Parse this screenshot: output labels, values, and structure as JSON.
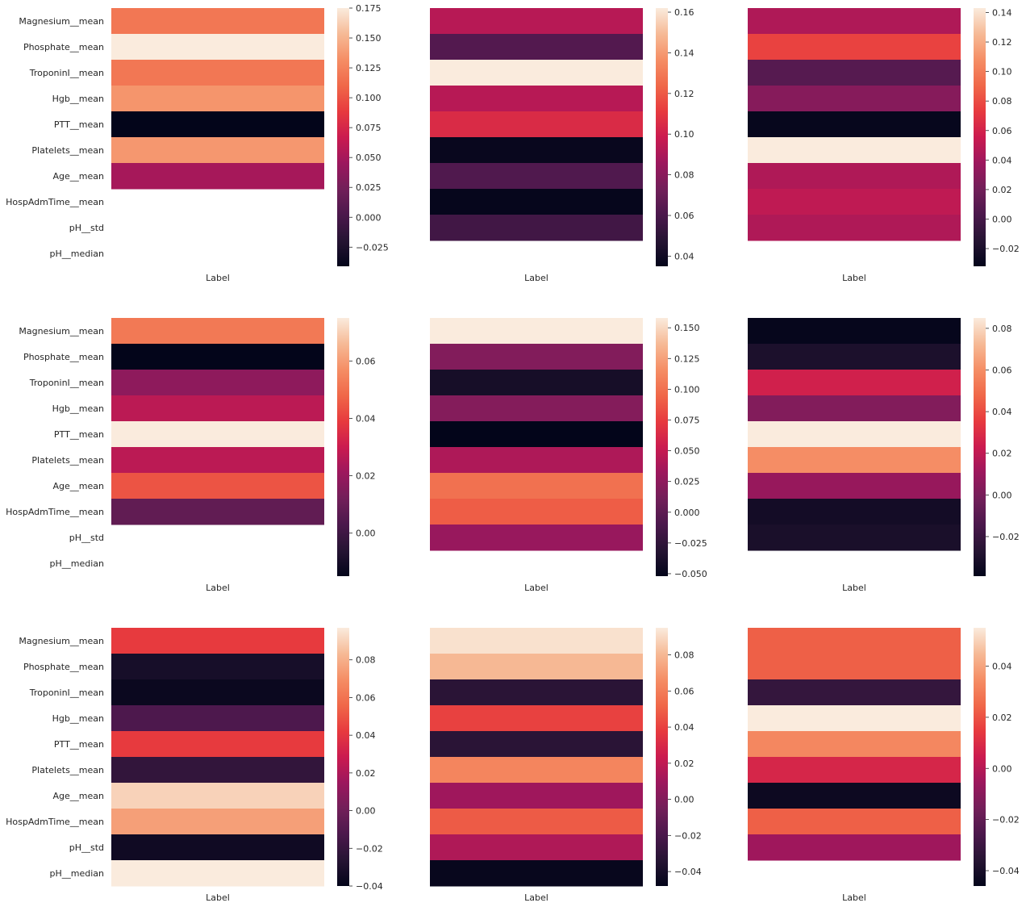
{
  "chart_data": [
    {
      "type": "heatmap",
      "xlabel": "Label",
      "ylabel": "",
      "show_row_labels": true,
      "rows": [
        "Magnesium__mean",
        "Phosphate__mean",
        "TroponinI__mean",
        "Hgb__mean",
        "PTT__mean",
        "Platelets__mean",
        "Age__mean",
        "HospAdmTime__mean",
        "pH__std",
        "pH__median"
      ],
      "values": [
        0.119,
        0.175,
        0.119,
        0.135,
        -0.041,
        0.136,
        0.05,
        null,
        null,
        null
      ],
      "vmin": -0.041,
      "vmax": 0.175,
      "colorbar_ticks": [
        -0.025,
        0.0,
        0.025,
        0.05,
        0.075,
        0.1,
        0.125,
        0.15,
        0.175
      ],
      "colorbar_tick_labels": [
        "−0.025",
        "0.000",
        "0.025",
        "0.050",
        "0.075",
        "0.100",
        "0.125",
        "0.150",
        "0.175"
      ]
    },
    {
      "type": "heatmap",
      "xlabel": "Label",
      "ylabel": "",
      "show_row_labels": false,
      "rows": [
        "Magnesium__mean",
        "Phosphate__mean",
        "TroponinI__mean",
        "Hgb__mean",
        "PTT__mean",
        "Platelets__mean",
        "Age__mean",
        "HospAdmTime__mean",
        "pH__std",
        "pH__median"
      ],
      "values": [
        0.093,
        0.063,
        0.162,
        0.093,
        0.105,
        0.037,
        0.062,
        0.036,
        0.057,
        null
      ],
      "vmin": 0.035,
      "vmax": 0.162,
      "colorbar_ticks": [
        0.04,
        0.06,
        0.08,
        0.1,
        0.12,
        0.14,
        0.16
      ],
      "colorbar_tick_labels": [
        "0.04",
        "0.06",
        "0.08",
        "0.10",
        "0.12",
        "0.14",
        "0.16"
      ]
    },
    {
      "type": "heatmap",
      "xlabel": "Label",
      "ylabel": "",
      "show_row_labels": false,
      "rows": [
        "Magnesium__mean",
        "Phosphate__mean",
        "TroponinI__mean",
        "Hgb__mean",
        "PTT__mean",
        "Platelets__mean",
        "Age__mean",
        "HospAdmTime__mean",
        "pH__std",
        "pH__median"
      ],
      "values": [
        0.045,
        0.076,
        0.008,
        0.029,
        -0.03,
        0.143,
        0.045,
        0.051,
        0.045,
        null
      ],
      "vmin": -0.032,
      "vmax": 0.143,
      "colorbar_ticks": [
        -0.02,
        0.0,
        0.02,
        0.04,
        0.06,
        0.08,
        0.1,
        0.12,
        0.14
      ],
      "colorbar_tick_labels": [
        "−0.02",
        "0.00",
        "0.02",
        "0.04",
        "0.06",
        "0.08",
        "0.10",
        "0.12",
        "0.14"
      ]
    },
    {
      "type": "heatmap",
      "xlabel": "Label",
      "ylabel": "",
      "show_row_labels": true,
      "rows": [
        "Magnesium__mean",
        "Phosphate__mean",
        "TroponinI__mean",
        "Hgb__mean",
        "PTT__mean",
        "Platelets__mean",
        "Age__mean",
        "HospAdmTime__mean",
        "pH__std",
        "pH__median"
      ],
      "values": [
        0.052,
        -0.015,
        0.018,
        0.027,
        0.075,
        0.027,
        0.044,
        0.008,
        null,
        null
      ],
      "vmin": -0.015,
      "vmax": 0.075,
      "colorbar_ticks": [
        0.0,
        0.02,
        0.04,
        0.06
      ],
      "colorbar_tick_labels": [
        "0.00",
        "0.02",
        "0.04",
        "0.06"
      ]
    },
    {
      "type": "heatmap",
      "xlabel": "Label",
      "ylabel": "",
      "show_row_labels": false,
      "rows": [
        "Magnesium__mean",
        "Phosphate__mean",
        "TroponinI__mean",
        "Hgb__mean",
        "PTT__mean",
        "Platelets__mean",
        "Age__mean",
        "HospAdmTime__mean",
        "pH__std",
        "pH__median"
      ],
      "values": [
        0.158,
        0.019,
        -0.04,
        0.02,
        -0.052,
        0.04,
        0.1,
        0.09,
        0.03,
        null
      ],
      "vmin": -0.052,
      "vmax": 0.158,
      "colorbar_ticks": [
        -0.05,
        -0.025,
        0.0,
        0.025,
        0.05,
        0.075,
        0.1,
        0.125,
        0.15
      ],
      "colorbar_tick_labels": [
        "−0.050",
        "−0.025",
        "0.000",
        "0.025",
        "0.050",
        "0.075",
        "0.100",
        "0.125",
        "0.150"
      ]
    },
    {
      "type": "heatmap",
      "xlabel": "Label",
      "ylabel": "",
      "show_row_labels": false,
      "rows": [
        "Magnesium__mean",
        "Phosphate__mean",
        "TroponinI__mean",
        "Hgb__mean",
        "PTT__mean",
        "Platelets__mean",
        "Age__mean",
        "HospAdmTime__mean",
        "pH__std",
        "pH__median"
      ],
      "values": [
        -0.038,
        -0.03,
        0.025,
        0.003,
        0.085,
        0.06,
        0.009,
        -0.033,
        -0.031,
        null
      ],
      "vmin": -0.039,
      "vmax": 0.085,
      "colorbar_ticks": [
        -0.02,
        0.0,
        0.02,
        0.04,
        0.06,
        0.08
      ],
      "colorbar_tick_labels": [
        "−0.02",
        "0.00",
        "0.02",
        "0.04",
        "0.06",
        "0.08"
      ]
    },
    {
      "type": "heatmap",
      "xlabel": "Label",
      "ylabel": "",
      "show_row_labels": true,
      "rows": [
        "Magnesium__mean",
        "Phosphate__mean",
        "TroponinI__mean",
        "Hgb__mean",
        "PTT__mean",
        "Platelets__mean",
        "Age__mean",
        "HospAdmTime__mean",
        "pH__std",
        "pH__median"
      ],
      "values": [
        0.042,
        -0.032,
        -0.037,
        -0.012,
        0.042,
        -0.022,
        0.09,
        0.075,
        -0.035,
        0.097
      ],
      "vmin": -0.04,
      "vmax": 0.097,
      "colorbar_ticks": [
        -0.04,
        -0.02,
        0.0,
        0.02,
        0.04,
        0.06,
        0.08
      ],
      "colorbar_tick_labels": [
        "−0.04",
        "−0.02",
        "0.00",
        "0.02",
        "0.04",
        "0.06",
        "0.08"
      ]
    },
    {
      "type": "heatmap",
      "xlabel": "Label",
      "ylabel": "",
      "show_row_labels": false,
      "rows": [
        "Magnesium__mean",
        "Phosphate__mean",
        "TroponinI__mean",
        "Hgb__mean",
        "PTT__mean",
        "Platelets__mean",
        "Age__mean",
        "HospAdmTime__mean",
        "pH__std",
        "pH__median"
      ],
      "values": [
        0.092,
        0.08,
        -0.032,
        0.04,
        -0.032,
        0.063,
        0.01,
        0.048,
        0.015,
        -0.046
      ],
      "vmin": -0.048,
      "vmax": 0.095,
      "colorbar_ticks": [
        -0.04,
        -0.02,
        0.0,
        0.02,
        0.04,
        0.06,
        0.08
      ],
      "colorbar_tick_labels": [
        "−0.04",
        "−0.02",
        "0.00",
        "0.02",
        "0.04",
        "0.06",
        "0.08"
      ]
    },
    {
      "type": "heatmap",
      "xlabel": "Label",
      "ylabel": "",
      "show_row_labels": false,
      "rows": [
        "Magnesium__mean",
        "Phosphate__mean",
        "TroponinI__mean",
        "Hgb__mean",
        "PTT__mean",
        "Platelets__mean",
        "Age__mean",
        "HospAdmTime__mean",
        "pH__std",
        "pH__median"
      ],
      "values": [
        0.023,
        0.023,
        -0.032,
        0.055,
        0.033,
        0.008,
        -0.043,
        0.023,
        -0.005,
        null
      ],
      "vmin": -0.046,
      "vmax": 0.055,
      "colorbar_ticks": [
        -0.04,
        -0.02,
        0.0,
        0.02,
        0.04
      ],
      "colorbar_tick_labels": [
        "−0.04",
        "−0.02",
        "0.00",
        "0.02",
        "0.04"
      ]
    }
  ]
}
